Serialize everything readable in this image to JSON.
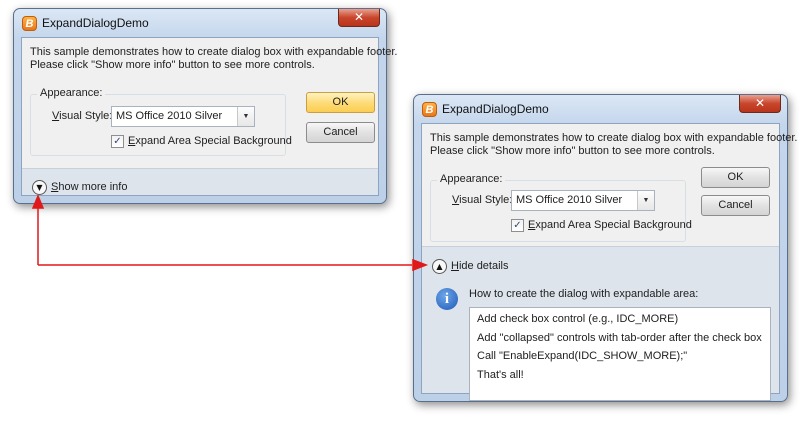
{
  "dialog_collapsed": {
    "title": "ExpandDialogDemo",
    "close_glyph": "✕",
    "app_icon_letter": "B",
    "description_line1": "This sample demonstrates how to create dialog box with expandable footer.",
    "description_line2": "Please click \"Show more info\" button to see more controls.",
    "appearance_group": "Appearance:",
    "visual_style_label": "Visual Style:",
    "visual_style_value": "MS Office 2010 Silver",
    "expand_bg_label": "Expand Area Special Background",
    "expand_bg_checked": true,
    "ok_label": "OK",
    "cancel_label": "Cancel",
    "footer_toggle_label": "Show more info"
  },
  "dialog_expanded": {
    "title": "ExpandDialogDemo",
    "close_glyph": "✕",
    "app_icon_letter": "B",
    "description_line1": "This sample demonstrates how to create dialog box with expandable footer.",
    "description_line2": "Please click \"Show more info\" button to see more controls.",
    "appearance_group": "Appearance:",
    "visual_style_label": "Visual Style:",
    "visual_style_value": "MS Office 2010 Silver",
    "expand_bg_label": "Expand Area Special Background",
    "expand_bg_checked": true,
    "ok_label": "OK",
    "cancel_label": "Cancel",
    "footer_toggle_label": "Hide details",
    "details_heading": "How to create the dialog with expandable area:",
    "details_lines": [
      "Add check box control (e.g., IDC_MORE)",
      "Add \"collapsed\" controls with tab-order after the check box",
      "Call \"EnableExpand(IDC_SHOW_MORE);\"",
      "That's all!"
    ]
  },
  "colors": {
    "connector_arrow": "#e0191a",
    "default_button": "#fbce51",
    "info_icon": "#1c59b6"
  }
}
